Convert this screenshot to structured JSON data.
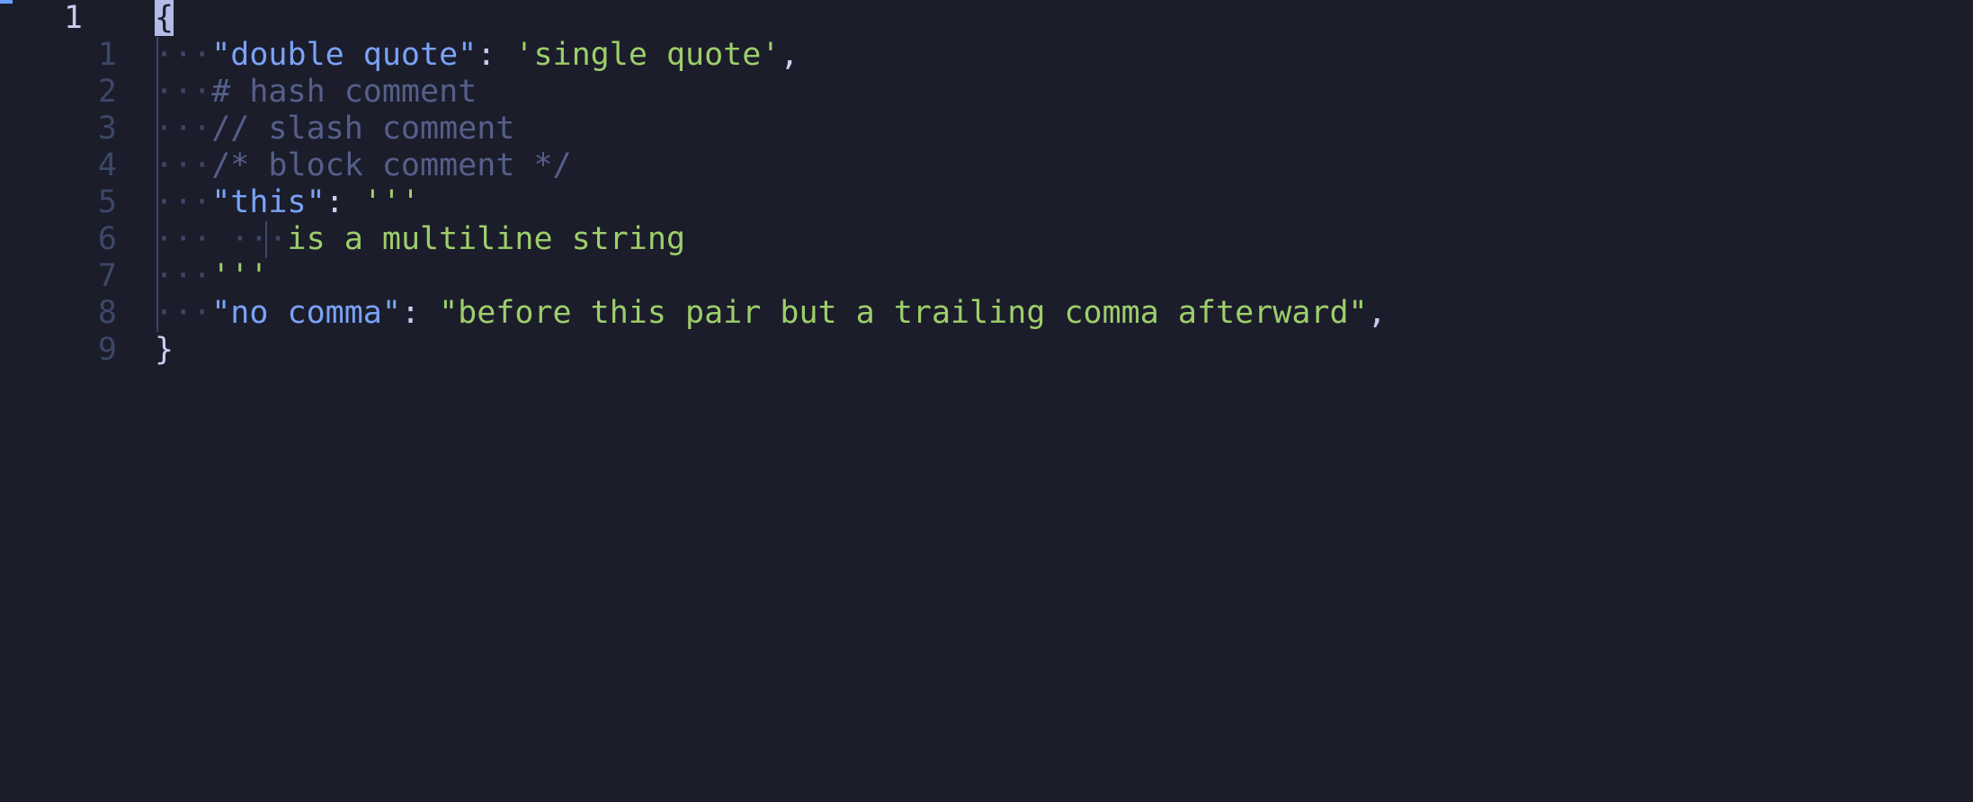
{
  "editor": {
    "background_color": "#1b1d2b",
    "font": "monospace",
    "corner_marker_color": "#6b9fff",
    "colors": {
      "key": "#7aa2f7",
      "string": "#9ece6a",
      "comment": "#565f89",
      "punctuation": "#c8cdf0",
      "brace": "#c8cdf0",
      "whitespace_dot": "#3d4766",
      "indent_guide": "#3d4766",
      "active_line_number": "#c8cdf0",
      "relative_line_number": "#3d4766",
      "cursor_background": "#b3bbe6",
      "cursor_foreground": "#1b1d2b"
    },
    "whitespace_dot_char": "·",
    "lines": [
      {
        "absolute_number": "1",
        "relative_number": "",
        "guides": 0,
        "is_active": true,
        "tokens": [
          {
            "kind": "brace",
            "text": "{",
            "cursor": true
          }
        ]
      },
      {
        "absolute_number": "",
        "relative_number": "1",
        "guides": 1,
        "is_active": false,
        "tokens": [
          {
            "kind": "ws",
            "text": "···"
          },
          {
            "kind": "key",
            "text": "\"double quote\""
          },
          {
            "kind": "punct",
            "text": ":"
          },
          {
            "kind": "plain",
            "text": " "
          },
          {
            "kind": "string",
            "text": "'single quote'"
          },
          {
            "kind": "punct",
            "text": ","
          }
        ]
      },
      {
        "absolute_number": "",
        "relative_number": "2",
        "guides": 1,
        "is_active": false,
        "tokens": [
          {
            "kind": "ws",
            "text": "···"
          },
          {
            "kind": "comment",
            "text": "# hash comment"
          }
        ]
      },
      {
        "absolute_number": "",
        "relative_number": "3",
        "guides": 1,
        "is_active": false,
        "tokens": [
          {
            "kind": "ws",
            "text": "···"
          },
          {
            "kind": "comment",
            "text": "// slash comment"
          }
        ]
      },
      {
        "absolute_number": "",
        "relative_number": "4",
        "guides": 1,
        "is_active": false,
        "tokens": [
          {
            "kind": "ws",
            "text": "···"
          },
          {
            "kind": "comment",
            "text": "/* block comment */"
          }
        ]
      },
      {
        "absolute_number": "",
        "relative_number": "5",
        "guides": 1,
        "is_active": false,
        "tokens": [
          {
            "kind": "ws",
            "text": "···"
          },
          {
            "kind": "key",
            "text": "\"this\""
          },
          {
            "kind": "punct",
            "text": ":"
          },
          {
            "kind": "plain",
            "text": " "
          },
          {
            "kind": "string",
            "text": "'''"
          }
        ]
      },
      {
        "absolute_number": "",
        "relative_number": "6",
        "guides": 2,
        "is_active": false,
        "tokens": [
          {
            "kind": "ws",
            "text": "···"
          },
          {
            "kind": "plain",
            "text": " "
          },
          {
            "kind": "ws",
            "text": "···"
          },
          {
            "kind": "string",
            "text": "is a multiline string"
          }
        ]
      },
      {
        "absolute_number": "",
        "relative_number": "7",
        "guides": 1,
        "is_active": false,
        "tokens": [
          {
            "kind": "ws",
            "text": "···"
          },
          {
            "kind": "string",
            "text": "'''"
          }
        ]
      },
      {
        "absolute_number": "",
        "relative_number": "8",
        "guides": 1,
        "is_active": false,
        "tokens": [
          {
            "kind": "ws",
            "text": "···"
          },
          {
            "kind": "key",
            "text": "\"no comma\""
          },
          {
            "kind": "punct",
            "text": ":"
          },
          {
            "kind": "plain",
            "text": " "
          },
          {
            "kind": "string",
            "text": "\"before this pair but a trailing comma afterward\""
          },
          {
            "kind": "punct",
            "text": ","
          }
        ]
      },
      {
        "absolute_number": "",
        "relative_number": "9",
        "guides": 0,
        "is_active": false,
        "tokens": [
          {
            "kind": "brace",
            "text": "}"
          }
        ]
      }
    ]
  }
}
